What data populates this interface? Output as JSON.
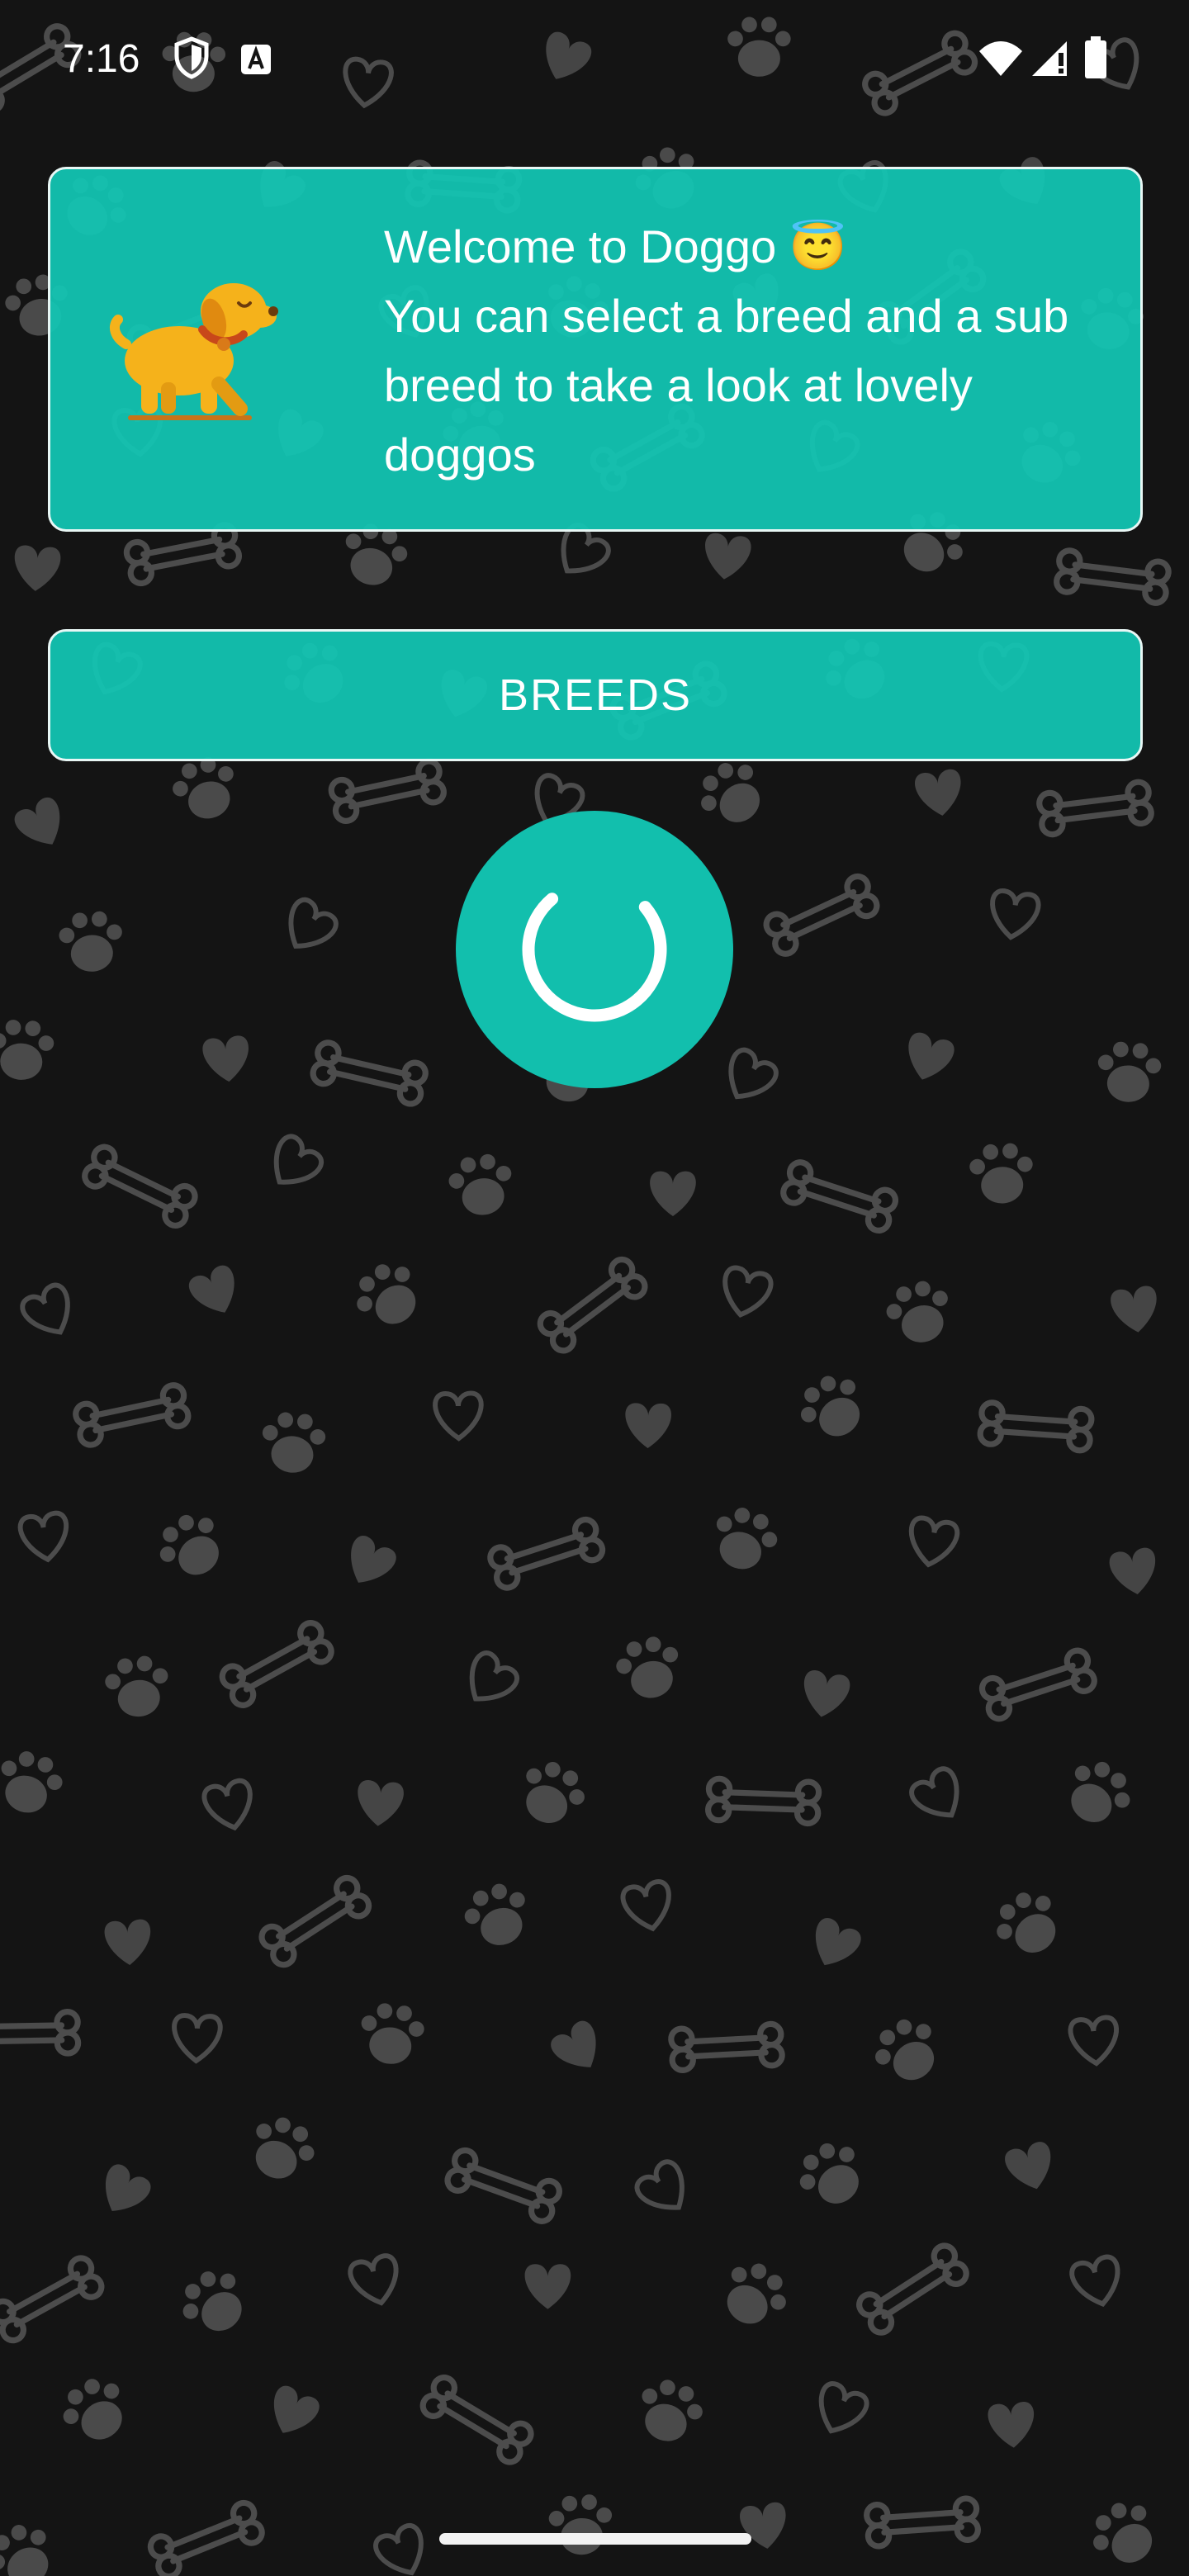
{
  "status_bar": {
    "time": "7:16",
    "left_icons": [
      "shield-icon",
      "keyboard-a-icon"
    ],
    "right_icons": [
      "wifi-icon",
      "signal-icon",
      "battery-icon"
    ]
  },
  "welcome_card": {
    "title": "Welcome to Doggo 😇",
    "message": "You can select a breed and a sub breed to take a look at lovely doggos",
    "image_icon": "dog-walking-icon"
  },
  "breeds_button": {
    "label": "BREEDS"
  },
  "loading": {
    "icon": "loading-spinner-icon"
  },
  "theme": {
    "background": "#141414",
    "accent": "#12C7B5",
    "pattern": "#4a4a4a",
    "dog": "#F5B21B"
  }
}
